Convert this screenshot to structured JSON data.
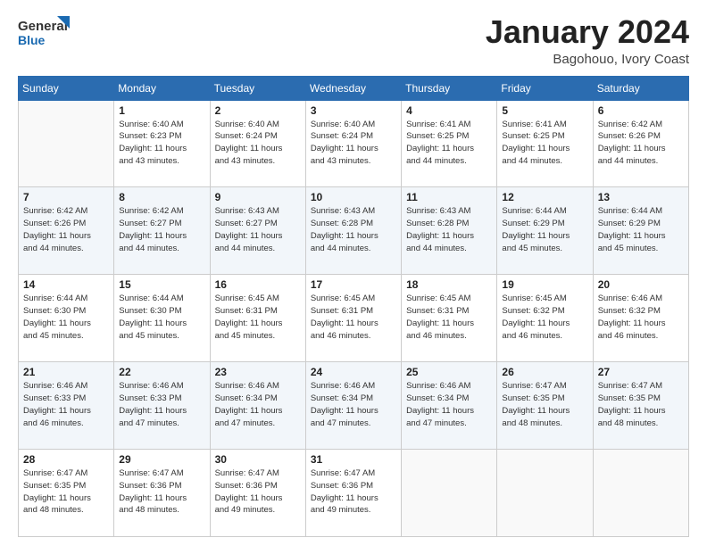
{
  "header": {
    "logo_line1": "General",
    "logo_line2": "Blue",
    "month": "January 2024",
    "location": "Bagohouo, Ivory Coast"
  },
  "weekdays": [
    "Sunday",
    "Monday",
    "Tuesday",
    "Wednesday",
    "Thursday",
    "Friday",
    "Saturday"
  ],
  "weeks": [
    [
      {
        "day": "",
        "info": ""
      },
      {
        "day": "1",
        "info": "Sunrise: 6:40 AM\nSunset: 6:23 PM\nDaylight: 11 hours\nand 43 minutes."
      },
      {
        "day": "2",
        "info": "Sunrise: 6:40 AM\nSunset: 6:24 PM\nDaylight: 11 hours\nand 43 minutes."
      },
      {
        "day": "3",
        "info": "Sunrise: 6:40 AM\nSunset: 6:24 PM\nDaylight: 11 hours\nand 43 minutes."
      },
      {
        "day": "4",
        "info": "Sunrise: 6:41 AM\nSunset: 6:25 PM\nDaylight: 11 hours\nand 44 minutes."
      },
      {
        "day": "5",
        "info": "Sunrise: 6:41 AM\nSunset: 6:25 PM\nDaylight: 11 hours\nand 44 minutes."
      },
      {
        "day": "6",
        "info": "Sunrise: 6:42 AM\nSunset: 6:26 PM\nDaylight: 11 hours\nand 44 minutes."
      }
    ],
    [
      {
        "day": "7",
        "info": "Sunrise: 6:42 AM\nSunset: 6:26 PM\nDaylight: 11 hours\nand 44 minutes."
      },
      {
        "day": "8",
        "info": "Sunrise: 6:42 AM\nSunset: 6:27 PM\nDaylight: 11 hours\nand 44 minutes."
      },
      {
        "day": "9",
        "info": "Sunrise: 6:43 AM\nSunset: 6:27 PM\nDaylight: 11 hours\nand 44 minutes."
      },
      {
        "day": "10",
        "info": "Sunrise: 6:43 AM\nSunset: 6:28 PM\nDaylight: 11 hours\nand 44 minutes."
      },
      {
        "day": "11",
        "info": "Sunrise: 6:43 AM\nSunset: 6:28 PM\nDaylight: 11 hours\nand 44 minutes."
      },
      {
        "day": "12",
        "info": "Sunrise: 6:44 AM\nSunset: 6:29 PM\nDaylight: 11 hours\nand 45 minutes."
      },
      {
        "day": "13",
        "info": "Sunrise: 6:44 AM\nSunset: 6:29 PM\nDaylight: 11 hours\nand 45 minutes."
      }
    ],
    [
      {
        "day": "14",
        "info": "Sunrise: 6:44 AM\nSunset: 6:30 PM\nDaylight: 11 hours\nand 45 minutes."
      },
      {
        "day": "15",
        "info": "Sunrise: 6:44 AM\nSunset: 6:30 PM\nDaylight: 11 hours\nand 45 minutes."
      },
      {
        "day": "16",
        "info": "Sunrise: 6:45 AM\nSunset: 6:31 PM\nDaylight: 11 hours\nand 45 minutes."
      },
      {
        "day": "17",
        "info": "Sunrise: 6:45 AM\nSunset: 6:31 PM\nDaylight: 11 hours\nand 46 minutes."
      },
      {
        "day": "18",
        "info": "Sunrise: 6:45 AM\nSunset: 6:31 PM\nDaylight: 11 hours\nand 46 minutes."
      },
      {
        "day": "19",
        "info": "Sunrise: 6:45 AM\nSunset: 6:32 PM\nDaylight: 11 hours\nand 46 minutes."
      },
      {
        "day": "20",
        "info": "Sunrise: 6:46 AM\nSunset: 6:32 PM\nDaylight: 11 hours\nand 46 minutes."
      }
    ],
    [
      {
        "day": "21",
        "info": "Sunrise: 6:46 AM\nSunset: 6:33 PM\nDaylight: 11 hours\nand 46 minutes."
      },
      {
        "day": "22",
        "info": "Sunrise: 6:46 AM\nSunset: 6:33 PM\nDaylight: 11 hours\nand 47 minutes."
      },
      {
        "day": "23",
        "info": "Sunrise: 6:46 AM\nSunset: 6:34 PM\nDaylight: 11 hours\nand 47 minutes."
      },
      {
        "day": "24",
        "info": "Sunrise: 6:46 AM\nSunset: 6:34 PM\nDaylight: 11 hours\nand 47 minutes."
      },
      {
        "day": "25",
        "info": "Sunrise: 6:46 AM\nSunset: 6:34 PM\nDaylight: 11 hours\nand 47 minutes."
      },
      {
        "day": "26",
        "info": "Sunrise: 6:47 AM\nSunset: 6:35 PM\nDaylight: 11 hours\nand 48 minutes."
      },
      {
        "day": "27",
        "info": "Sunrise: 6:47 AM\nSunset: 6:35 PM\nDaylight: 11 hours\nand 48 minutes."
      }
    ],
    [
      {
        "day": "28",
        "info": "Sunrise: 6:47 AM\nSunset: 6:35 PM\nDaylight: 11 hours\nand 48 minutes."
      },
      {
        "day": "29",
        "info": "Sunrise: 6:47 AM\nSunset: 6:36 PM\nDaylight: 11 hours\nand 48 minutes."
      },
      {
        "day": "30",
        "info": "Sunrise: 6:47 AM\nSunset: 6:36 PM\nDaylight: 11 hours\nand 49 minutes."
      },
      {
        "day": "31",
        "info": "Sunrise: 6:47 AM\nSunset: 6:36 PM\nDaylight: 11 hours\nand 49 minutes."
      },
      {
        "day": "",
        "info": ""
      },
      {
        "day": "",
        "info": ""
      },
      {
        "day": "",
        "info": ""
      }
    ]
  ]
}
